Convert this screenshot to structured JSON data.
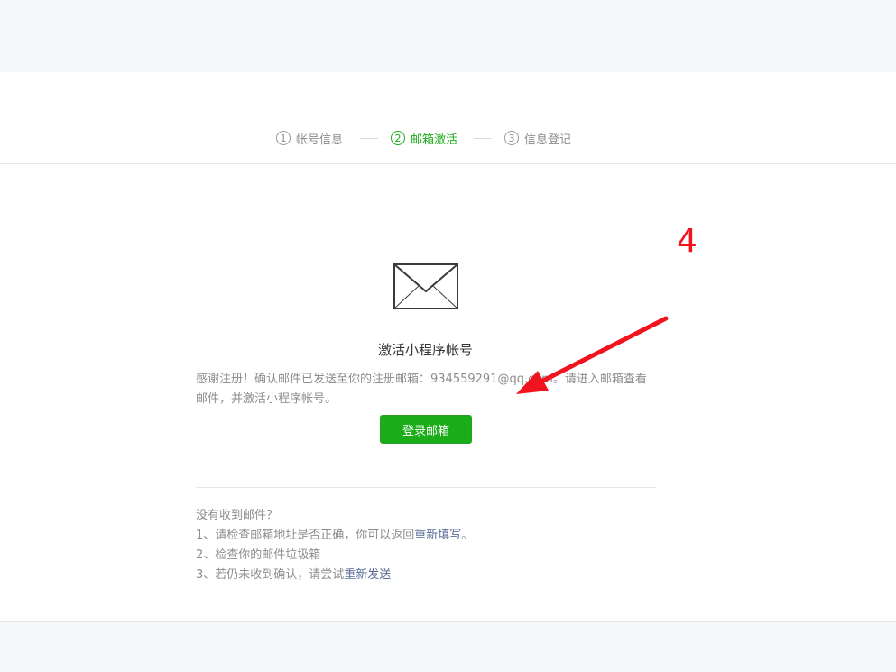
{
  "steps": [
    {
      "num": "1",
      "label": "帐号信息"
    },
    {
      "num": "2",
      "label": "邮箱激活"
    },
    {
      "num": "3",
      "label": "信息登记"
    }
  ],
  "main": {
    "title": "激活小程序帐号",
    "description": "感谢注册！确认邮件已发送至你的注册邮箱：934559291@qq.com。请进入邮箱查看邮件，并激活小程序帐号。",
    "login_button": "登录邮箱"
  },
  "help": {
    "heading": "没有收到邮件？",
    "line1_prefix": "1、请检查邮箱地址是否正确，你可以返回",
    "line1_link": "重新填写",
    "line1_suffix": "。",
    "line2": "2、检查你的邮件垃圾箱",
    "line3_prefix": "3、若仍未收到确认，请尝试",
    "line3_link": "重新发送"
  },
  "annotation": {
    "number": "4",
    "color": "#f0141e"
  },
  "colors": {
    "accent": "#1aad19",
    "link": "#576b95"
  },
  "icons": {
    "mail": "mail-envelope-icon"
  }
}
